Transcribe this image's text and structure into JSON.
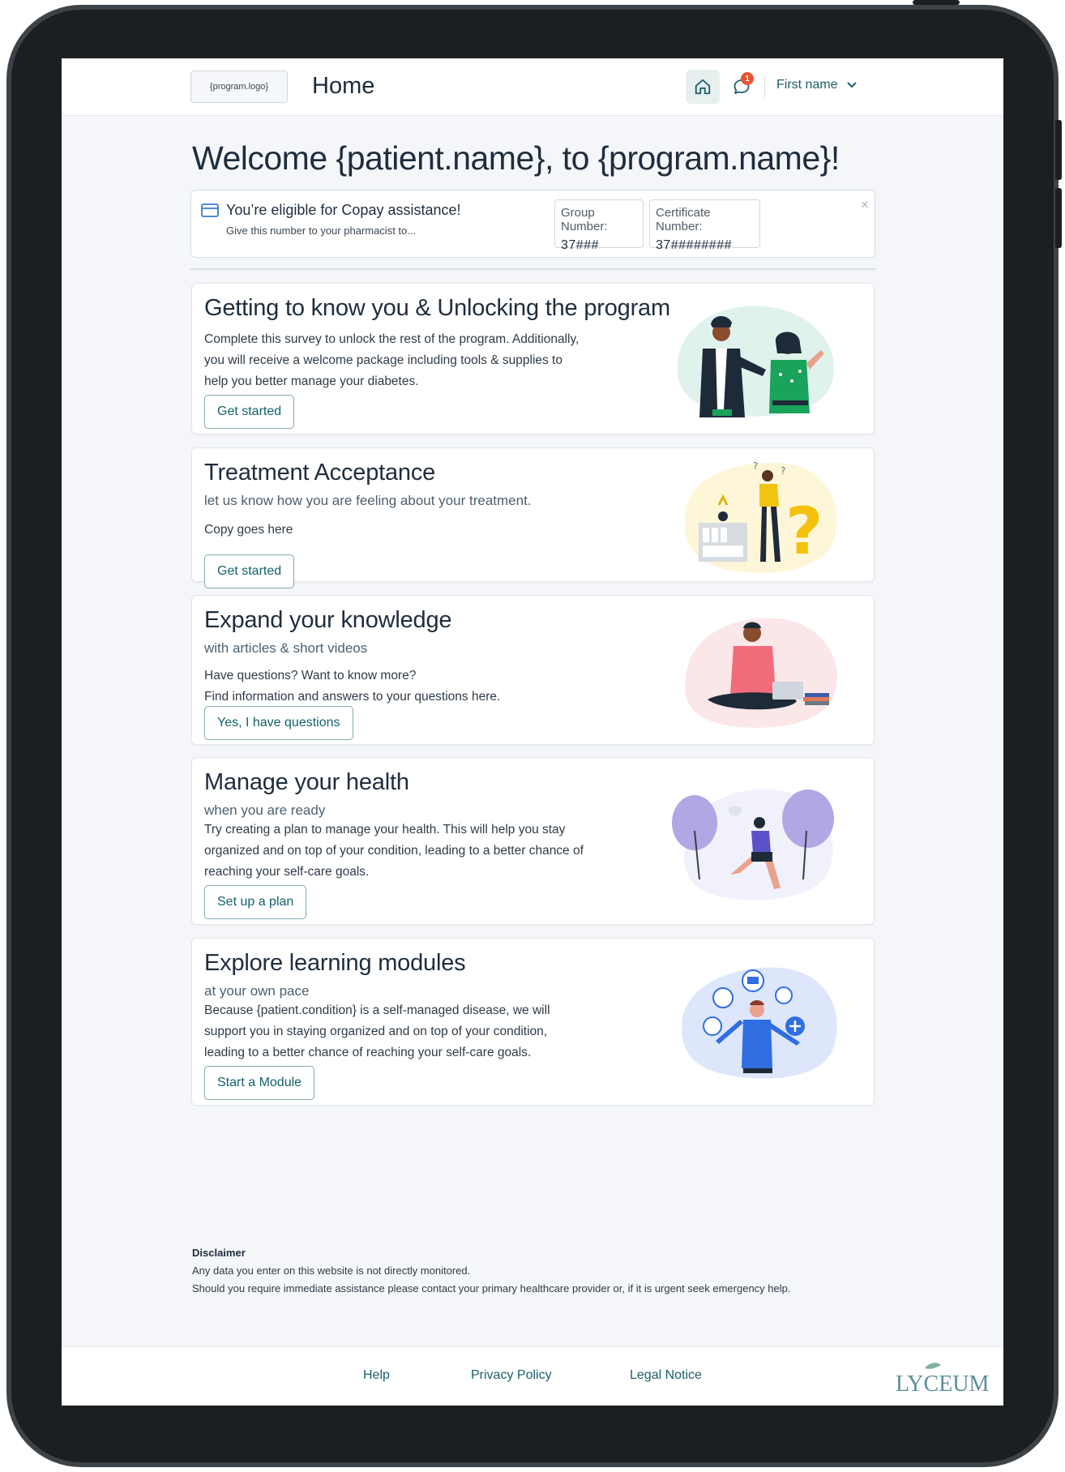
{
  "header": {
    "logo": "{program.logo}",
    "title": "Home",
    "notification_count": "1",
    "user_name": "First name",
    "icons": {
      "home": "home-icon",
      "chat": "chat-icon",
      "menu": "chevron-down-icon"
    }
  },
  "welcome": "Welcome {patient.name}, to {program.name}!",
  "copay": {
    "title": "You’re eligible for Copay assistance!",
    "subtitle": "Give this number to your pharmacist to...",
    "group_label": "Group Number:",
    "group_value": "37###",
    "cert_label": "Certificate Number:",
    "cert_value": "37########",
    "close": "×"
  },
  "cards": [
    {
      "title": "Getting to know you & Unlocking the program",
      "body": "Complete this survey to unlock the rest of the program. Additionally, you will receive a welcome package including tools & supplies to help you better manage your diabetes.",
      "button": "Get started"
    },
    {
      "title": "Treatment Acceptance",
      "subtitle": "let us know how you are feeling about your treatment.",
      "body": "Copy goes here",
      "button": "Get started"
    },
    {
      "title": "Expand your knowledge",
      "subtitle": "with articles & short videos",
      "body_line1": "Have questions? Want to know more?",
      "body_line2": "Find information and answers to your questions here.",
      "button": "Yes, I have questions"
    },
    {
      "title": "Manage your health",
      "subtitle": "when you are ready",
      "body": "Try creating a plan to manage your health. This will help you stay organized and on top of your condition, leading to a better chance of reaching your self-care goals.",
      "button": "Set up a plan"
    },
    {
      "title": "Explore learning modules",
      "subtitle": "at your own pace",
      "body": "Because {patient.condition} is a self-managed disease, we will support you in staying organized and on top of your condition, leading to a better chance of reaching your self-care goals.",
      "button": "Start a Module"
    }
  ],
  "disclaimer": {
    "heading": "Disclaimer",
    "line1": "Any data you enter on this website is not directly monitored.",
    "line2": "Should you require immediate assistance please contact your primary healthcare provider or, if it is urgent seek emergency help."
  },
  "footer": {
    "links": [
      "Help",
      "Privacy Policy",
      "Legal Notice"
    ],
    "brand": "LYCEUM"
  },
  "colors": {
    "accent": "#14616c",
    "badge": "#e8542f",
    "background": "#f4f6f9"
  }
}
